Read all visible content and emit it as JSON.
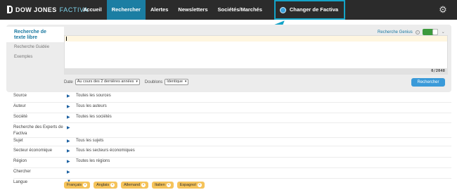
{
  "brand": {
    "name": "DOW JONES",
    "product": "FACTIVA"
  },
  "nav": {
    "items": [
      {
        "label": "Accueil"
      },
      {
        "label": "Rechercher"
      },
      {
        "label": "Alertes"
      },
      {
        "label": "Newsletters"
      },
      {
        "label": "Sociétés/Marchés"
      }
    ],
    "switch_label": "Changer de Factiva"
  },
  "panel": {
    "menu": {
      "active": "Recherche de texte libre",
      "guided": "Recherche Guidée",
      "examples": "Exemples"
    },
    "genius_label": "Recherche Genius",
    "char_count": "0/2048",
    "date_label": "Date",
    "date_value": "Au cours des 2 dernières années",
    "duplicates_label": "Doublons",
    "duplicates_value": "Identique",
    "search_button": "Rechercher"
  },
  "criteria": [
    {
      "label": "Source",
      "value": "Toutes les sources"
    },
    {
      "label": "Auteur",
      "value": "Tous les auteurs"
    },
    {
      "label": "Société",
      "value": "Toutes les sociétés"
    },
    {
      "label": "Recherche des Experts de Factiva",
      "value": ""
    },
    {
      "label": "Sujet",
      "value": "Tous les sujets"
    },
    {
      "label": "Secteur économique",
      "value": "Tous les secteurs économiques"
    },
    {
      "label": "Région",
      "value": "Toutes les régions"
    },
    {
      "label": "Chercher",
      "value": ""
    },
    {
      "label": "Langue",
      "value": ""
    }
  ],
  "languages": [
    "Français",
    "Anglais",
    "Allemand",
    "Italien",
    "Espagnol"
  ],
  "colors": {
    "topbar": "#2b2b2b",
    "active_tab": "#1b7ea3",
    "annotation": "#14a3c7",
    "chip": "#f5c35a",
    "button": "#3a9ad9"
  }
}
